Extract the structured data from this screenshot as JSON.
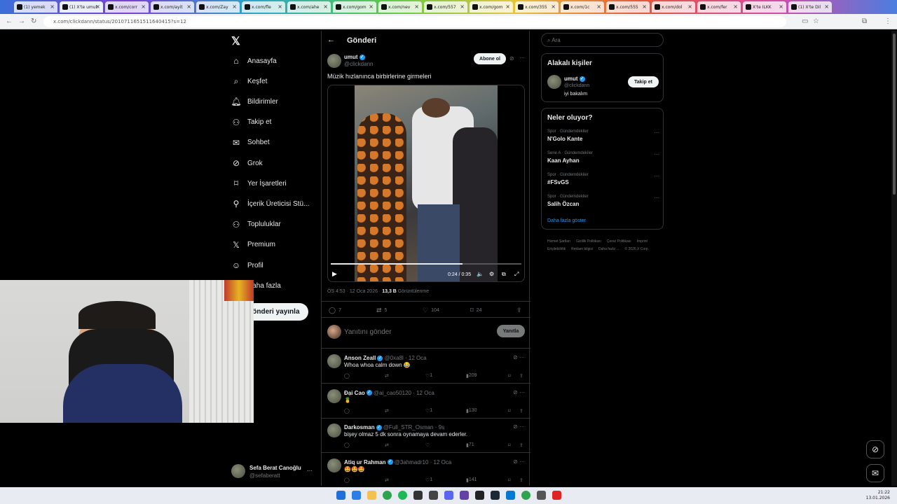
{
  "browser": {
    "tabs": [
      {
        "title": "(1) yemek"
      },
      {
        "title": "(1) X'te umut"
      },
      {
        "title": "x.com/corr"
      },
      {
        "title": "x.com/ayit"
      },
      {
        "title": "x.com/Zay"
      },
      {
        "title": "x.com/fle"
      },
      {
        "title": "x.com/ahe"
      },
      {
        "title": "x.com/gom"
      },
      {
        "title": "x.com/nev"
      },
      {
        "title": "x.com/557"
      },
      {
        "title": "x.com/gom"
      },
      {
        "title": "x.com/355"
      },
      {
        "title": "x.com/1c"
      },
      {
        "title": "x.com/555"
      },
      {
        "title": "x.com/dol"
      },
      {
        "title": "x.com/fer"
      },
      {
        "title": "X'te ILKK"
      },
      {
        "title": "(1) X'te Dil"
      }
    ],
    "url": "x.com/clickdann/status/2010711651511640415?s=12"
  },
  "sidebar": {
    "items": [
      {
        "label": "Anasayfa",
        "icon": "home-icon"
      },
      {
        "label": "Keşfet",
        "icon": "search-icon"
      },
      {
        "label": "Bildirimler",
        "icon": "bell-icon"
      },
      {
        "label": "Takip et",
        "icon": "add-user-icon"
      },
      {
        "label": "Sohbet",
        "icon": "mail-icon"
      },
      {
        "label": "Grok",
        "icon": "grok-icon"
      },
      {
        "label": "Yer İşaretleri",
        "icon": "bookmark-icon"
      },
      {
        "label": "İçerik Üreticisi Stü...",
        "icon": "creator-icon"
      },
      {
        "label": "Topluluklar",
        "icon": "communities-icon"
      },
      {
        "label": "Premium",
        "icon": "x-icon"
      },
      {
        "label": "Profil",
        "icon": "profile-icon"
      },
      {
        "label": "Daha fazla",
        "icon": "more-icon"
      }
    ],
    "post_button": "Gönderi yayınla",
    "account": {
      "name": "Sefa Berat Canoğlu",
      "handle": "@sefaberatt"
    }
  },
  "post": {
    "header_title": "Gönderi",
    "author_name": "umut",
    "author_handle": "@clickdann",
    "subscribe_label": "Abone ol",
    "text": "Müzik hızlanınca birbirlerine girmeleri",
    "video_time": "0:24 / 0:35",
    "video_progress": 0.69,
    "timestamp": "ÖS 4:53 · 12 Oca 2026 · ",
    "views_count": "13,3 B",
    "views_label": "Görüntülenme",
    "stats": {
      "replies": "7",
      "reposts": "5",
      "likes": "104",
      "bookmarks": "24"
    },
    "reply_placeholder": "Yanıtını gönder",
    "reply_button": "Yanıtla"
  },
  "replies": [
    {
      "name": "Anson Zeall",
      "handle": "@0xa8l · 12 Oca",
      "text": "Whoa whoa calm down 😂",
      "likes": "1",
      "views": "209"
    },
    {
      "name": "Đại Cao",
      "handle": "@ai_cao50120 · 12 Oca",
      "text": "🍍",
      "likes": "1",
      "views": "130"
    },
    {
      "name": "Darkosman",
      "handle": "@Full_STR_Osman · 9s",
      "text": "bişey olmaz 5 dk sonra oynamaya devam ederler.",
      "likes": "",
      "views": "71"
    },
    {
      "name": "Atiq ur Rahman",
      "handle": "@3ahmadr10 · 12 Oca",
      "text": "🤩🤩🤩",
      "likes": "1",
      "views": "141"
    }
  ],
  "right": {
    "search_placeholder": "Ara",
    "relevant": {
      "title": "Alakalı kişiler",
      "name": "umut",
      "handle": "@clickdann",
      "bio": "iyi bakalım",
      "follow_label": "Takip et"
    },
    "trends": {
      "title": "Neler oluyor?",
      "items": [
        {
          "category": "Spor · Gündemdekiler",
          "name": "N'Golo Kante"
        },
        {
          "category": "Serie A · Gündemdekiler",
          "name": "Kaan Ayhan"
        },
        {
          "category": "Spor · Gündemdekiler",
          "name": "#FSvGS"
        },
        {
          "category": "Spor · Gündemdekiler",
          "name": "Salih Özcan"
        }
      ],
      "more_label": "Daha fazla göster"
    },
    "footer": [
      "Hizmet Şartları",
      "Gizlilik Politikası",
      "Çerez Politikası",
      "Imprint",
      "Erişilebilirlik",
      "Reklam bilgisi",
      "Daha fazla ...",
      "© 2026 X Corp."
    ]
  },
  "taskbar": {
    "time": "21:22",
    "date": "13.01.2026"
  },
  "colors": {
    "accent": "#1d9bf0",
    "background": "#000000",
    "border": "#2f3336"
  }
}
